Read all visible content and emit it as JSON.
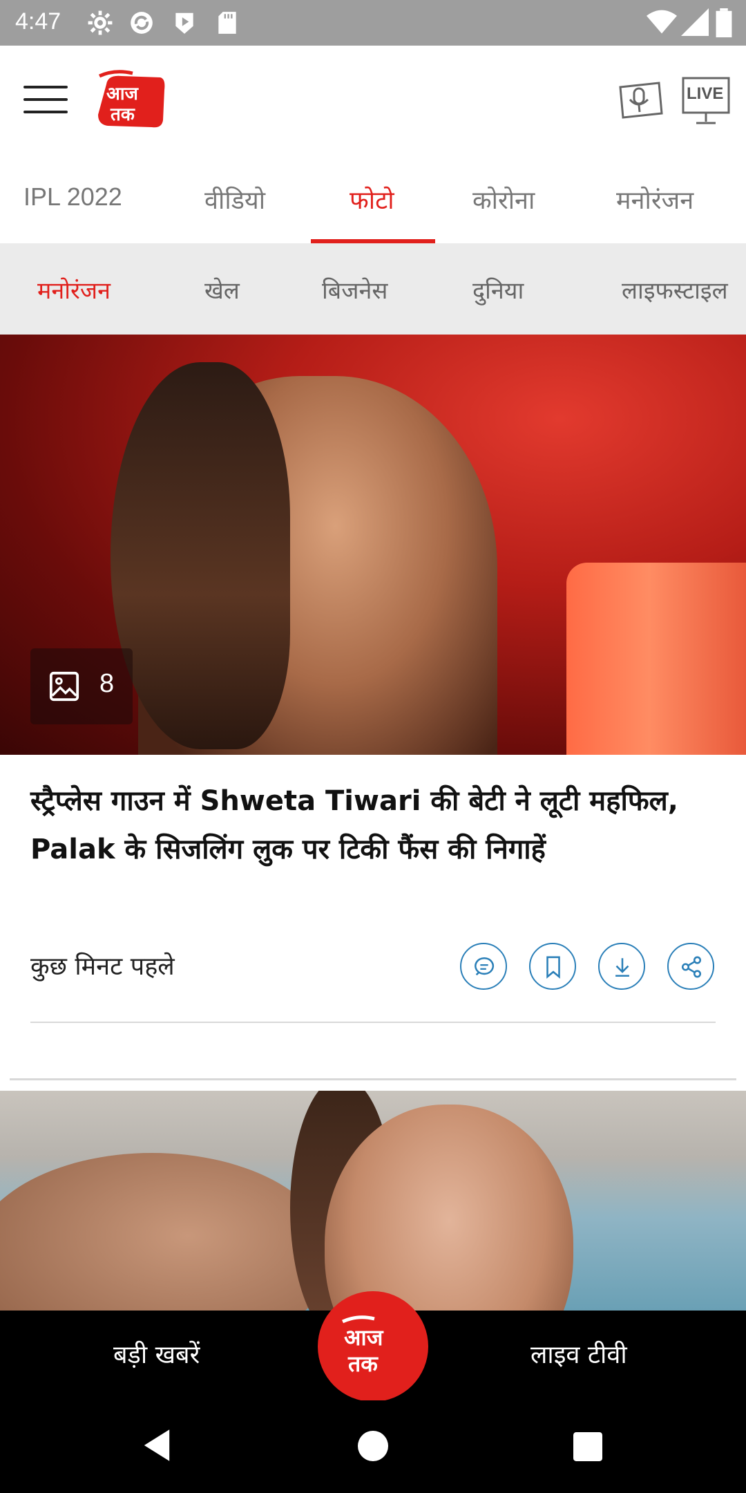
{
  "status_bar": {
    "time": "4:47",
    "icons": [
      "settings-icon",
      "sync-icon",
      "play-store-icon",
      "sd-card-icon"
    ],
    "right_icons": [
      "wifi-icon",
      "signal-icon",
      "battery-icon"
    ]
  },
  "header": {
    "menu_icon": "hamburger-menu-icon",
    "logo_text": "आज तक",
    "podcast_icon": "podcast-icon",
    "live_label": "LIVE"
  },
  "tabs": [
    {
      "label": "IPL 2022",
      "active": false
    },
    {
      "label": "वीडियो",
      "active": false
    },
    {
      "label": "फोटो",
      "active": true
    },
    {
      "label": "कोरोना",
      "active": false
    },
    {
      "label": "मनोरंजन",
      "active": false
    }
  ],
  "subtabs": [
    {
      "label": "मनोरंजन",
      "active": true
    },
    {
      "label": "खेल",
      "active": false
    },
    {
      "label": "बिजनेस",
      "active": false
    },
    {
      "label": "दुनिया",
      "active": false
    },
    {
      "label": "लाइफस्टाइल",
      "active": false
    }
  ],
  "articles": [
    {
      "photo_count": "8",
      "headline": "स्ट्रैप्लेस गाउन में Shweta Tiwari की बेटी ने लूटी महफिल, Palak के सिजलिंग लुक पर टिकी फैंस की निगाहें",
      "timestamp": "कुछ मिनट पहले",
      "actions": [
        "comment-icon",
        "bookmark-icon",
        "download-icon",
        "share-icon"
      ]
    }
  ],
  "bottom_nav": {
    "left_label": "बड़ी खबरें",
    "center_logo": "आज तक",
    "right_label": "लाइव टीवी"
  },
  "colors": {
    "accent": "#e1201c",
    "action_blue": "#2a7fb8",
    "statusbar": "#9e9e9e",
    "subtabs_bg": "#ebebeb"
  }
}
